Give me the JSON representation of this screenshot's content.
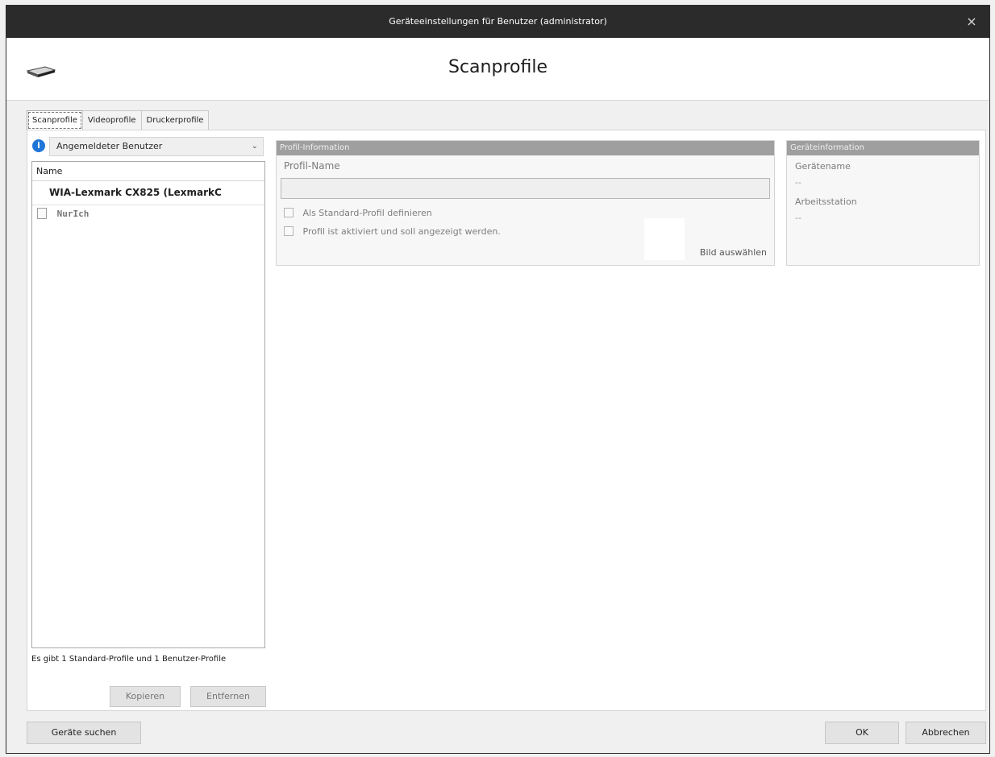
{
  "window": {
    "title": "Geräteeinstellungen für Benutzer (administrator)",
    "close_icon": "close-icon"
  },
  "header": {
    "title": "Scanprofile",
    "icon": "scanner-icon"
  },
  "tabs": [
    {
      "label": "Scanprofile",
      "active": true
    },
    {
      "label": "Videoprofile",
      "active": false
    },
    {
      "label": "Druckerprofile",
      "active": false
    }
  ],
  "left_panel": {
    "info_icon": "info-icon",
    "user_select": {
      "value": "Angemeldeter Benutzer",
      "chevron_icon": "chevron-down-icon"
    },
    "list": {
      "header": "Name",
      "device": "WIA-Lexmark CX825 (LexmarkC",
      "profile": "NurIch",
      "profile_icon": "document-icon"
    },
    "status": "Es gibt 1 Standard-Profile und 1 Benutzer-Profile",
    "buttons": {
      "copy": "Kopieren",
      "remove": "Entfernen"
    }
  },
  "profile_info": {
    "header": "Profil-Information",
    "name_label": "Profil-Name",
    "name_value": "",
    "default_checkbox": "Als Standard-Profil definieren",
    "active_checkbox": "Profil ist aktiviert und soll angezeigt werden.",
    "image_button": "Bild auswählen"
  },
  "device_info": {
    "header": "Geräteinformation",
    "device_label": "Gerätename",
    "device_value": "--",
    "station_label": "Arbeitsstation",
    "station_value": "--"
  },
  "footer": {
    "search_button": "Geräte suchen",
    "ok_button": "OK",
    "cancel_button": "Abbrechen"
  },
  "colors": {
    "titlebar": "#2b2b2b",
    "info_icon": "#1f76d8",
    "panel_header": "#9f9f9f"
  }
}
